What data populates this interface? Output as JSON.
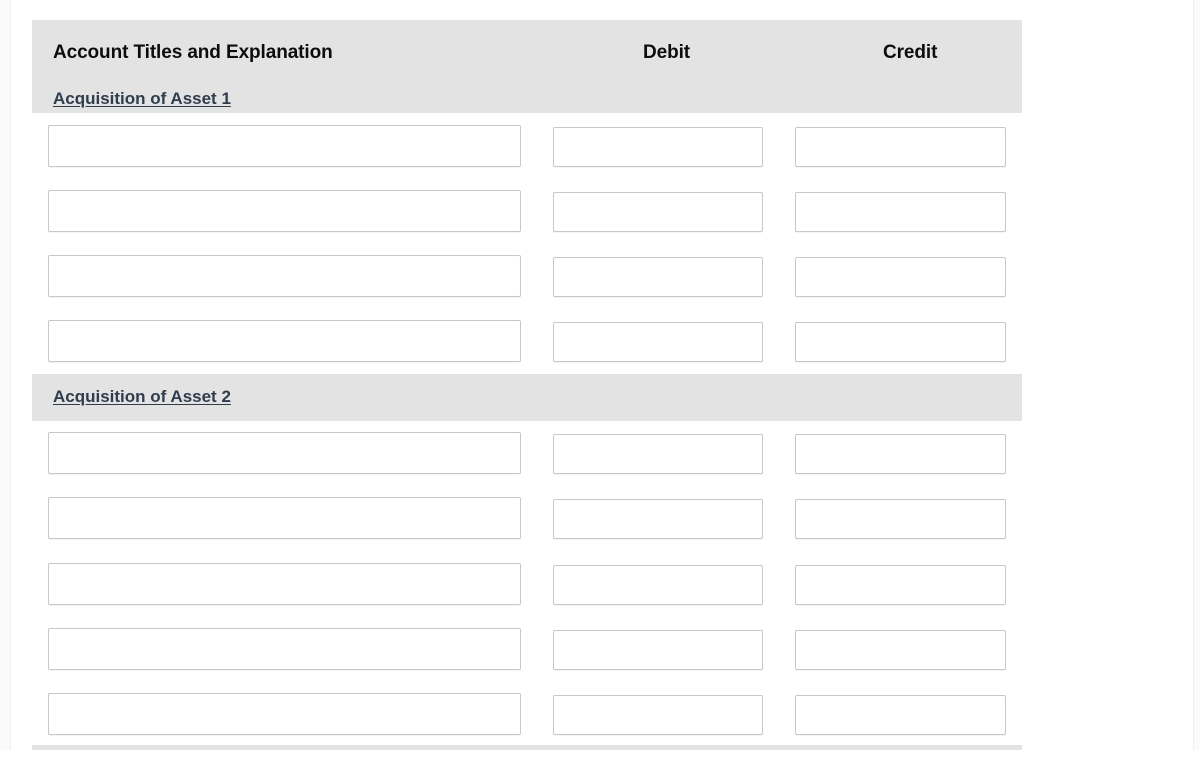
{
  "table": {
    "columns": {
      "account": "Account Titles and Explanation",
      "debit": "Debit",
      "credit": "Credit"
    },
    "sections": [
      {
        "label": "Acquisition of Asset 1",
        "label_in_header": true,
        "rows": [
          {
            "account": "",
            "debit": "",
            "credit": ""
          },
          {
            "account": "",
            "debit": "",
            "credit": ""
          },
          {
            "account": "",
            "debit": "",
            "credit": ""
          },
          {
            "account": "",
            "debit": "",
            "credit": ""
          }
        ]
      },
      {
        "label": "Acquisition of Asset 2",
        "label_in_header": false,
        "rows": [
          {
            "account": "",
            "debit": "",
            "credit": ""
          },
          {
            "account": "",
            "debit": "",
            "credit": ""
          },
          {
            "account": "",
            "debit": "",
            "credit": ""
          },
          {
            "account": "",
            "debit": "",
            "credit": ""
          },
          {
            "account": "",
            "debit": "",
            "credit": ""
          }
        ]
      }
    ],
    "placeholders": {
      "account": "",
      "debit": "",
      "credit": ""
    }
  },
  "colors": {
    "header_band": "#e3e3e3",
    "section_label_text": "#2f3d4c",
    "column_title_text": "#0d0d0d",
    "input_border": "#c8c8c8",
    "page_background": "#ffffff"
  }
}
